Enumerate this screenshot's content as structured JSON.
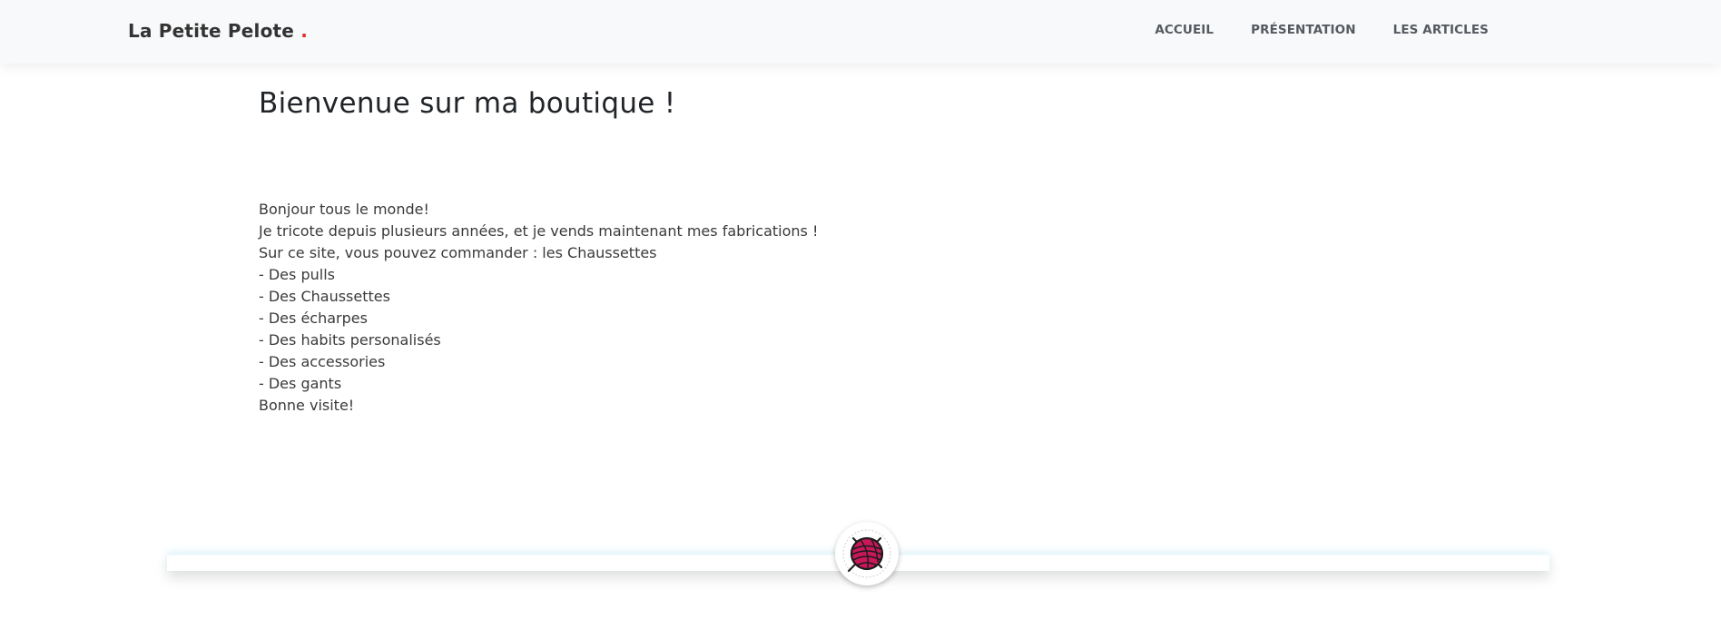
{
  "header": {
    "brand": "La Petite Pelote",
    "brand_dot": ".",
    "nav": [
      {
        "label": "ACCUEIL"
      },
      {
        "label": "PRÉSENTATION"
      },
      {
        "label": "LES ARTICLES"
      }
    ]
  },
  "main": {
    "title": "Bienvenue sur ma boutique !",
    "lines": [
      "Bonjour tous le monde!",
      "Je tricote depuis plusieurs années, et je vends maintenant mes fabrications !",
      "Sur ce site, vous pouvez commander : les Chaussettes",
      "- Des pulls",
      "- Des Chaussettes",
      "- Des écharpes",
      "- Des habits personalisés",
      "- Des accessories",
      "- Des gants",
      "Bonne visite!"
    ]
  },
  "footer": {
    "logo_icon": "yarn-ball-icon"
  },
  "colors": {
    "accent_dot": "#e32929",
    "yarn": "#c8185a",
    "navbar_bg": "#f8f9fa"
  }
}
